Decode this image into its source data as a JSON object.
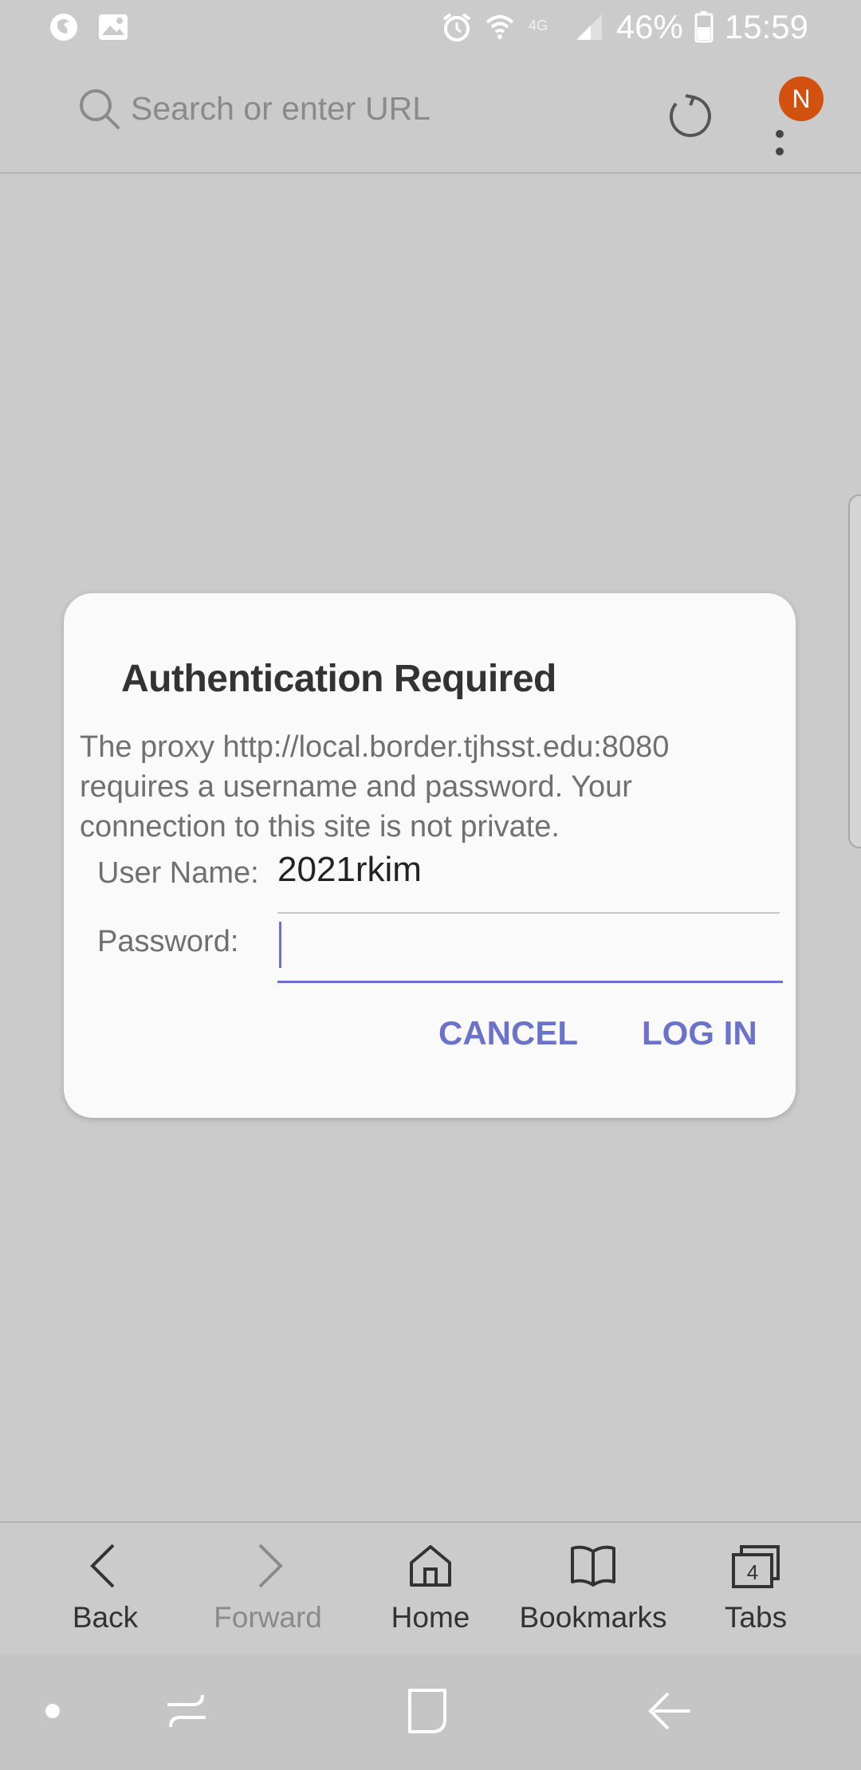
{
  "status_bar": {
    "battery": "46%",
    "time": "15:59",
    "icons": [
      "firefox-icon",
      "image-icon",
      "alarm-icon",
      "wifi-icon",
      "4g-icon",
      "signal-icon",
      "battery-icon"
    ]
  },
  "toolbar": {
    "search_placeholder": "Search or enter URL",
    "avatar_letter": "N",
    "avatar_color": "#d2510f"
  },
  "dialog": {
    "title": "Authentication Required",
    "message": "The proxy http://local.border.tjhsst.edu:8080 requires a username and password. Your connection to this site is not private.",
    "username_label": "User Name:",
    "username_value": "2021rkim",
    "password_label": "Password:",
    "password_value": "",
    "cancel_label": "CANCEL",
    "login_label": "LOG IN",
    "accent_color": "#6a72c9"
  },
  "bottom_bar": {
    "items": [
      {
        "label": "Back",
        "icon": "chevron-left-icon"
      },
      {
        "label": "Forward",
        "icon": "chevron-right-icon"
      },
      {
        "label": "Home",
        "icon": "home-icon"
      },
      {
        "label": "Bookmarks",
        "icon": "bookmarks-icon"
      },
      {
        "label": "Tabs",
        "icon": "tabs-icon",
        "count": "4"
      }
    ]
  }
}
